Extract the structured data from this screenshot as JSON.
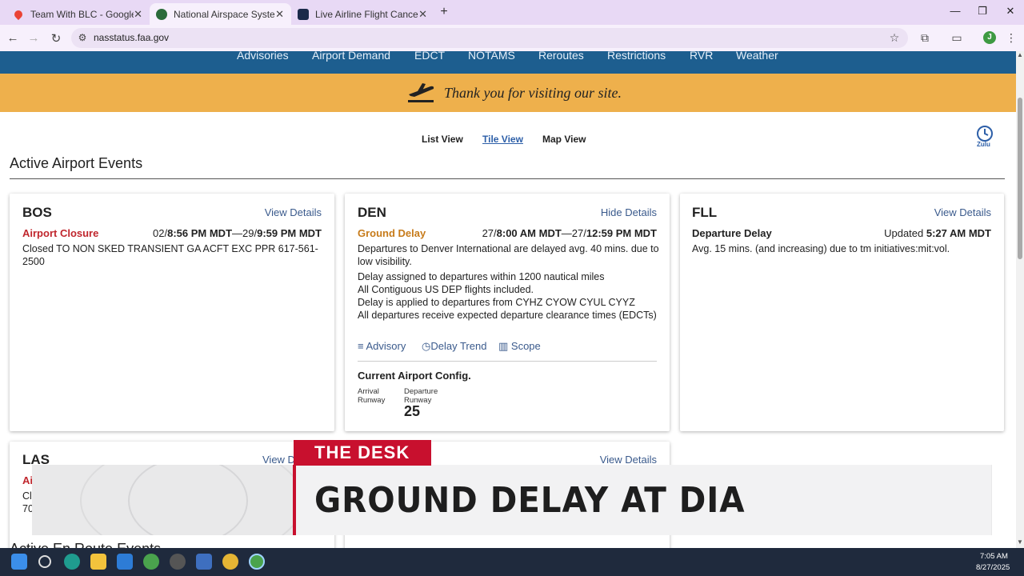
{
  "browser": {
    "tabs": [
      {
        "title": "Team With BLC - Google Maps",
        "icon": "map-pin-icon",
        "color": "#ea4335"
      },
      {
        "title": "National Airspace System",
        "icon": "faa-seal-icon",
        "color": "#2b6b3a"
      },
      {
        "title": "Live Airline Flight Cancellations",
        "icon": "plane-icon",
        "color": "#1b2a4a"
      }
    ],
    "url": "nasstatus.faa.gov",
    "profile_initial": "J"
  },
  "site": {
    "nav": [
      "Advisories",
      "Airport Demand",
      "EDCT",
      "NOTAMS",
      "Reroutes",
      "Restrictions",
      "RVR",
      "Weather"
    ],
    "banner": "Thank you for visiting our site.",
    "view_tabs": [
      "List View",
      "Tile View",
      "Map View"
    ],
    "active_view": "Tile View",
    "zulu_label": "Zulu",
    "section_title": "Active Airport Events",
    "next_section_title": "Active En Route Events"
  },
  "cards": {
    "bos": {
      "code": "BOS",
      "details": "View Details",
      "event": "Airport Closure",
      "time_prefix1": "02/",
      "time1": "8:56 PM MDT",
      "time_sep": "—29/",
      "time2": "9:59 PM MDT",
      "body": "Closed TO NON SKED TRANSIENT GA ACFT EXC PPR 617-561-2500"
    },
    "den": {
      "code": "DEN",
      "details": "Hide Details",
      "event": "Ground Delay",
      "time_prefix1": "27/",
      "time1": "8:00 AM MDT",
      "time_sep": "—27/",
      "time2": "12:59 PM MDT",
      "body1": "Departures to Denver International are delayed avg. 40 mins. due to low visibility.",
      "body2": "Delay assigned to departures within 1200 nautical miles",
      "body3": "All Contiguous US DEP flights included.",
      "body4": "Delay is applied to departures from CYHZ CYOW CYUL CYYZ",
      "body5": "All departures receive expected departure clearance times (EDCTs)",
      "link_advisory": "Advisory",
      "link_trend": "Delay Trend",
      "link_scope": "Scope",
      "config_title": "Current Airport Config.",
      "arrival_label": "Arrival Runway",
      "departure_label": "Departure Runway",
      "departure_runway": "25"
    },
    "fll": {
      "code": "FLL",
      "details": "View Details",
      "event": "Departure Delay",
      "updated_label": "Updated ",
      "updated_time": "5:27 AM MDT",
      "body": "Avg. 15 mins. (and increasing) due to tm initiatives:mit:vol."
    },
    "las": {
      "code": "LAS",
      "details": "View D",
      "partial_event": "Ai",
      "partial_body1": "Cl",
      "partial_body2": "70"
    },
    "card5": {
      "details": "View Details"
    }
  },
  "news": {
    "tag": "THE DESK",
    "headline": "GROUND DELAY AT DIA",
    "accent": "#c8102e"
  },
  "taskbar": {
    "time": "7:05 AM",
    "date": "8/27/2025"
  }
}
